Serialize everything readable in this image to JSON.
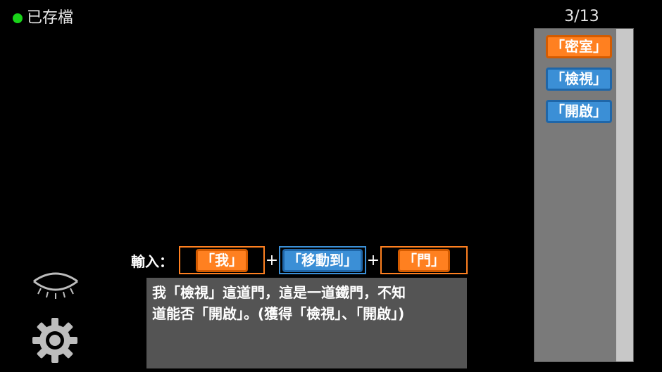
{
  "save_status": {
    "text": "已存檔",
    "indicator_color": "#19d319"
  },
  "counter": "3/13",
  "word_list": [
    {
      "label": "「密室」",
      "color": "orange"
    },
    {
      "label": "「檢視」",
      "color": "blue"
    },
    {
      "label": "「開啟」",
      "color": "blue"
    }
  ],
  "input": {
    "label": "輸入：",
    "slots": [
      {
        "value": "「我」",
        "color": "orange"
      },
      {
        "value": "「移動到」",
        "color": "blue"
      },
      {
        "value": "「門」",
        "color": "orange"
      }
    ],
    "plus": "+"
  },
  "message": {
    "line1": "我「檢視」這道門，這是一道鐵門，不知",
    "line2": "道能否「開啟」。(獲得「檢視」、「開啟」)"
  },
  "icons": {
    "eye": "eye-closed-icon",
    "gear": "gear-icon"
  },
  "colors": {
    "orange": "#ff8020",
    "blue": "#3b8fd6",
    "panel": "#7a7a7a",
    "message_bg": "#545454"
  }
}
